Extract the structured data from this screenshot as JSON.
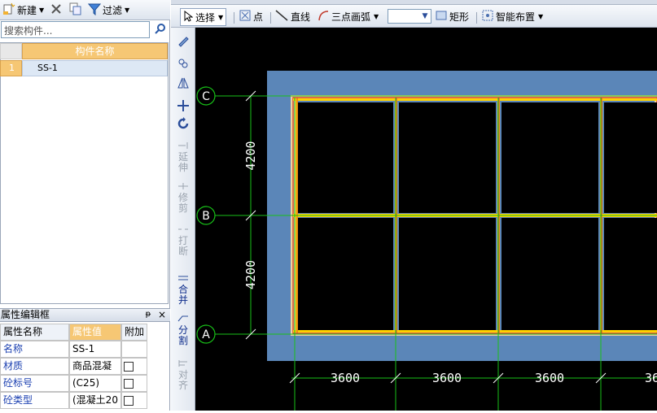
{
  "left_toolbar": {
    "new_label": "新建",
    "filter_label": "过滤"
  },
  "search": {
    "placeholder": "搜索构件..."
  },
  "component_list": {
    "header": "构件名称",
    "rows": [
      {
        "index": "1",
        "name": "SS-1"
      }
    ]
  },
  "property_panel": {
    "title": "属性编辑框",
    "pin": "ᵽ",
    "close": "×",
    "columns": [
      "属性名称",
      "属性值",
      "附加"
    ],
    "rows": [
      {
        "name": "名称",
        "value": "SS-1",
        "checkbox": false
      },
      {
        "name": "材质",
        "value": "商品混凝",
        "checkbox": true
      },
      {
        "name": "砼标号",
        "value": "(C25)",
        "checkbox": true
      },
      {
        "name": "砼类型",
        "value": "(混凝土20",
        "checkbox": true
      }
    ]
  },
  "main_toolbar": {
    "select": "选择",
    "point": "点",
    "line": "直线",
    "arc": "三点画弧",
    "rect": "矩形",
    "smart": "智能布置"
  },
  "tool_strip": {
    "extend": "延伸",
    "trim": "修剪",
    "break": "打断",
    "merge": "合并",
    "split": "分割",
    "align": "对齐"
  },
  "drawing": {
    "axis_rows": [
      "C",
      "B",
      "A"
    ],
    "row_spacing": [
      "4200",
      "4200"
    ],
    "col_spacing": [
      "3600",
      "3600",
      "3600",
      "36"
    ],
    "colors": {
      "slab": "#5b86b8",
      "beam": "#ffd200",
      "frame": "#d84a2a",
      "axis": "#18c018",
      "dims": "#ffffff"
    }
  }
}
